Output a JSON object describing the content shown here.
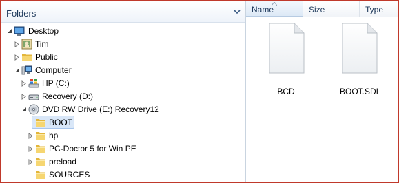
{
  "folders_pane": {
    "title": "Folders",
    "tree": [
      {
        "label": "Desktop",
        "icon": "desktop-icon",
        "level": 0,
        "state": "expanded"
      },
      {
        "label": "Tim",
        "icon": "user-folder-icon",
        "level": 1,
        "state": "collapsed"
      },
      {
        "label": "Public",
        "icon": "folder-icon",
        "level": 1,
        "state": "collapsed"
      },
      {
        "label": "Computer",
        "icon": "computer-icon",
        "level": 1,
        "state": "expanded"
      },
      {
        "label": "HP (C:)",
        "icon": "windows-drive-icon",
        "level": 2,
        "state": "collapsed"
      },
      {
        "label": "Recovery (D:)",
        "icon": "hard-drive-icon",
        "level": 2,
        "state": "collapsed"
      },
      {
        "label": "DVD RW Drive (E:) Recovery12",
        "icon": "dvd-drive-icon",
        "level": 2,
        "state": "expanded"
      },
      {
        "label": "BOOT",
        "icon": "folder-icon",
        "level": 3,
        "state": "none",
        "selected": true
      },
      {
        "label": "hp",
        "icon": "folder-icon",
        "level": 3,
        "state": "collapsed"
      },
      {
        "label": "PC-Doctor 5 for Win PE",
        "icon": "folder-icon",
        "level": 3,
        "state": "collapsed"
      },
      {
        "label": "preload",
        "icon": "folder-icon",
        "level": 3,
        "state": "collapsed"
      },
      {
        "label": "SOURCES",
        "icon": "folder-icon",
        "level": 3,
        "state": "none"
      }
    ]
  },
  "file_pane": {
    "columns": [
      {
        "label": "Name",
        "sorted": true
      },
      {
        "label": "Size"
      },
      {
        "label": "Type"
      }
    ],
    "files": [
      {
        "name": "BCD",
        "icon": "blank-document-icon"
      },
      {
        "name": "BOOT.SDI",
        "icon": "blank-document-icon"
      }
    ]
  },
  "colors": {
    "frame_border": "#c0392b",
    "selection_fill": "#d9e7f8",
    "selection_border": "#a9c6ec",
    "header_text": "#1e395b",
    "folder_yellow": "#f3cd5a"
  }
}
